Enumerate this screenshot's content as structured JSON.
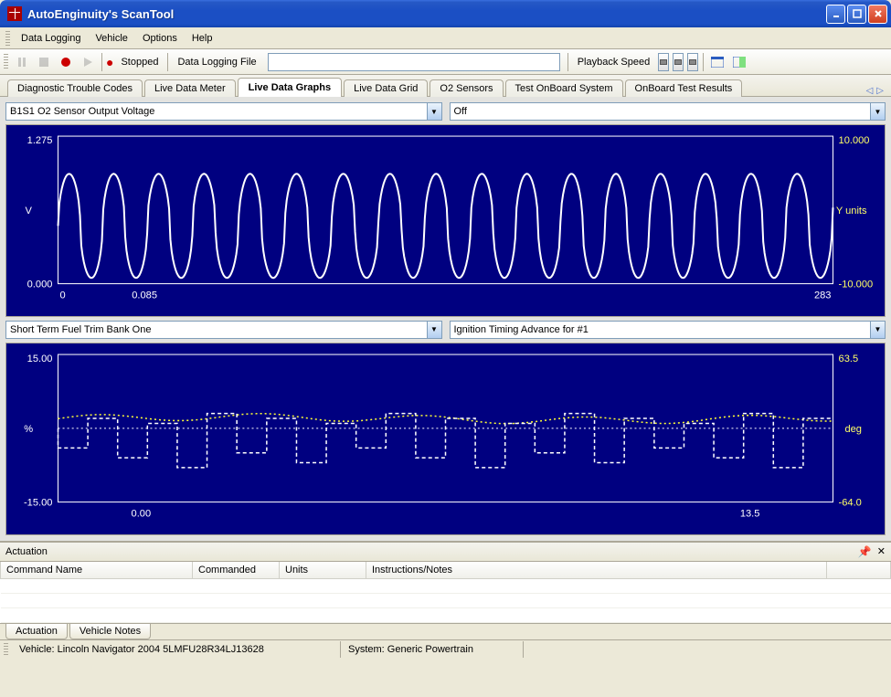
{
  "window": {
    "title": "AutoEnginuity's ScanTool"
  },
  "menu": {
    "data_logging": "Data Logging",
    "vehicle": "Vehicle",
    "options": "Options",
    "help": "Help"
  },
  "toolbar": {
    "stopped_label": "Stopped",
    "file_label": "Data Logging File",
    "file_value": "",
    "playback_label": "Playback Speed"
  },
  "tabs": {
    "dtc": "Diagnostic Trouble Codes",
    "meter": "Live Data Meter",
    "graphs": "Live Data Graphs",
    "grid": "Live Data Grid",
    "o2": "O2 Sensors",
    "onboard": "Test OnBoard System",
    "results": "OnBoard Test Results"
  },
  "graphs": {
    "sel1_left": "B1S1 O2 Sensor Output Voltage",
    "sel1_right": "Off",
    "sel2_left": "Short Term Fuel Trim Bank One",
    "sel2_right": "Ignition Timing Advance for #1",
    "chart1": {
      "ylabel": "V",
      "y2label": "Y units",
      "ymax": "1.275",
      "ymin": "0.000",
      "y2max": "10.000",
      "y2min": "-10.000",
      "xmin": "0",
      "xtick": "0.085",
      "xmax": "283"
    },
    "chart2": {
      "ylabel": "%",
      "y2label": "deg",
      "ymax": "15.00",
      "ymin": "-15.00",
      "y2max": "63.5",
      "y2min": "-64.0",
      "xmin": "0.00",
      "xmax": "13.5"
    }
  },
  "chart_data": [
    {
      "type": "line",
      "title": "B1S1 O2 Sensor Output Voltage",
      "xlabel": "",
      "ylabel": "V",
      "ylim": [
        0.0,
        1.275
      ],
      "x_range_displayed": [
        0,
        283
      ],
      "series": [
        {
          "name": "B1S1 O2 Sensor Output Voltage",
          "units": "V",
          "description": "oscillating roughly 0.05–0.95 V at ~17 cycles across window",
          "approx_min": 0.05,
          "approx_max": 0.95
        }
      ],
      "y2": {
        "label": "Y units",
        "lim": [
          -10.0,
          10.0
        ],
        "series": "Off"
      }
    },
    {
      "type": "line",
      "title": "Short Term Fuel Trim Bank One / Ignition Timing Advance for #1",
      "xlabel": "",
      "x_range_displayed": [
        0.0,
        13.5
      ],
      "series": [
        {
          "name": "Short Term Fuel Trim Bank One",
          "units": "%",
          "axis": "left",
          "ylim": [
            -15.0,
            15.0
          ],
          "description": "stepped white dashed trace mostly between roughly -5 and +2 %"
        },
        {
          "name": "Ignition Timing Advance for #1",
          "units": "deg",
          "axis": "right",
          "ylim": [
            -64.0,
            63.5
          ],
          "description": "yellow dotted trace near +5 to +12 deg, slowly varying"
        }
      ]
    }
  ],
  "actuation": {
    "panel_title": "Actuation",
    "col_command": "Command Name",
    "col_commanded": "Commanded",
    "col_units": "Units",
    "col_notes": "Instructions/Notes",
    "tab_actuation": "Actuation",
    "tab_notes": "Vehicle Notes"
  },
  "status": {
    "vehicle": "Vehicle: Lincoln  Navigator 2004 5LMFU28R34LJ13628",
    "system": "System: Generic Powertrain"
  }
}
